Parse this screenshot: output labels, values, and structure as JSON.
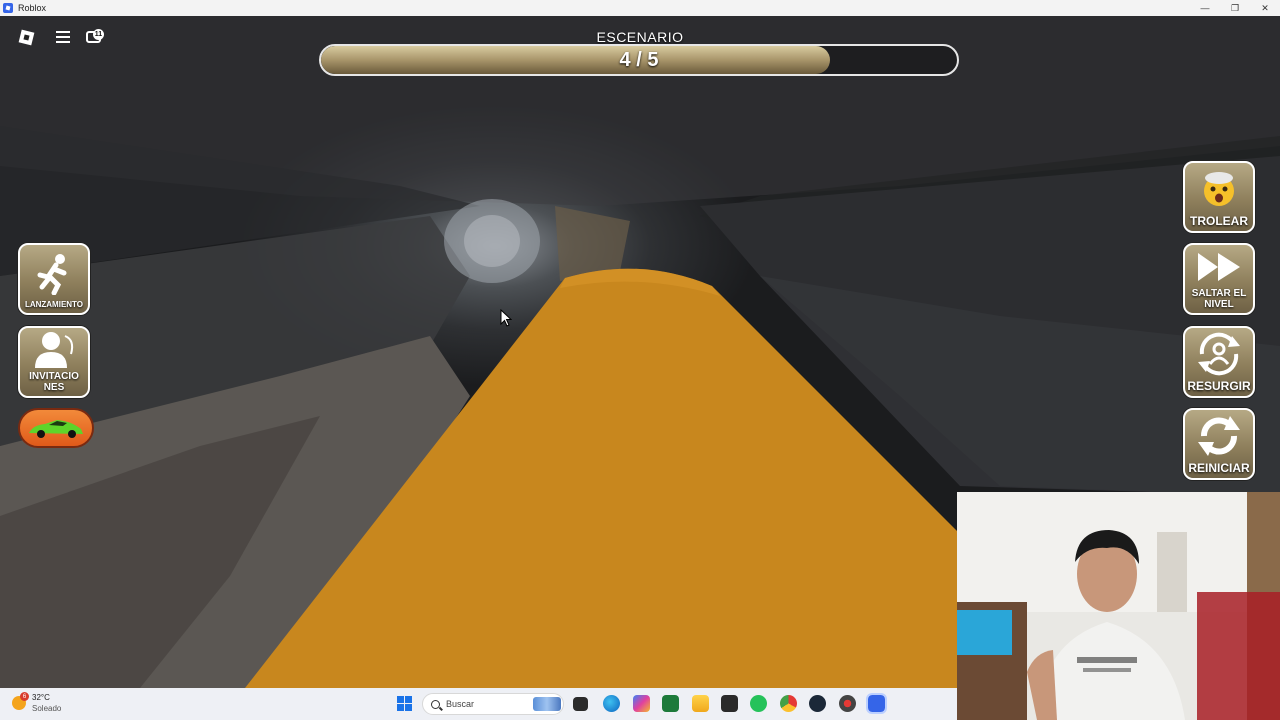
{
  "window": {
    "title": "Roblox",
    "controls": [
      "—",
      "❐",
      "✕"
    ]
  },
  "hud": {
    "chat_count": "11",
    "stage": {
      "title": "ESCENARIO",
      "count": "4 / 5",
      "progress": 0.8
    }
  },
  "left_buttons": [
    {
      "name": "lanzamiento-button",
      "label": "LANZAMIENTO",
      "icon": "kicking-figure-icon"
    },
    {
      "name": "invitaciones-button",
      "label": "INVITACIO\nNES",
      "icon": "add-friend-icon"
    },
    {
      "name": "car-button",
      "label": "",
      "icon": "sports-car-icon"
    }
  ],
  "right_buttons": [
    {
      "name": "trolear-button",
      "label": "TROLEAR",
      "icon": "mind-blown-emoji-icon"
    },
    {
      "name": "saltar-nivel-button",
      "label": "SALTAR EL NIVEL",
      "icon": "fast-forward-icon"
    },
    {
      "name": "resurgir-button",
      "label": "RESURGIR",
      "icon": "respawn-icon"
    },
    {
      "name": "reiniciar-button",
      "label": "REINICIAR",
      "icon": "restart-icon"
    }
  ],
  "taskbar": {
    "weather": {
      "temp": "32°C",
      "condition": "Soleado",
      "badge": "6"
    },
    "search_placeholder": "Buscar",
    "pinned_icons": [
      "task-view-icon",
      "edge-icon",
      "copilot-icon",
      "spreadsheet-icon",
      "file-explorer-icon",
      "epic-games-icon",
      "whatsapp-icon",
      "chrome-icon",
      "steam-icon",
      "record-icon",
      "roblox-icon"
    ]
  },
  "colors": {
    "walkway": "#C8871E",
    "stage_fill": "#A8956A",
    "button_bg": "#8E7F5C"
  }
}
